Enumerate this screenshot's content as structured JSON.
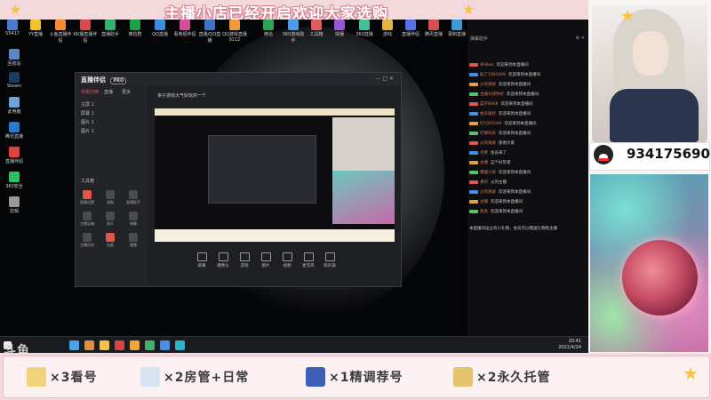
{
  "banner": {
    "title": "主播小店已经开启欢迎大家选购"
  },
  "desktop": {
    "top_icons": [
      "55417",
      "YY直播",
      "斗鱼直播伴侣",
      "KK播直播伴侣",
      "直播助手",
      "微信群",
      "QQ直播",
      "看电视伴侣",
      "直播/QQ直播",
      "QQ游戏直播9112",
      "微信",
      "360游戏助手",
      "工具箱",
      "快播",
      "360直播",
      "游戏",
      "直播伴侣",
      "腾讯直播",
      "录制直播",
      "TV直播"
    ],
    "side_icons": [
      "回收站",
      "Steam",
      "此电脑",
      "腾讯直播",
      "直播伴侣",
      "360安全",
      "剪辑"
    ]
  },
  "taskbar": {
    "time": "20:41",
    "date": "2022/4/24"
  },
  "app": {
    "title": "直播伴侣",
    "tag": "PRO",
    "tabs": [
      "场景切换",
      "直播",
      "更多"
    ],
    "scenes": [
      "主屏 1",
      "屏幕 1",
      "图片 1",
      "图片 1"
    ],
    "tools_title": "工具箱",
    "tools": [
      "直播设置",
      "录制",
      "直播助手",
      "主播宝箱",
      "观众",
      "弹幕",
      "主播任务",
      "连麦",
      "看播"
    ],
    "bottom_tools": [
      "屏幕",
      "摄像头",
      "游戏",
      "图片",
      "视频",
      "麦克风",
      "扬声器"
    ],
    "preview_title": "亲子游戏大气好玩的一个"
  },
  "chat": {
    "header": "弹幕助手",
    "lines": [
      {
        "user": "Wiilkes",
        "text": "欢迎来到本直播间"
      },
      {
        "user": "贴了1001h09",
        "text": "欢迎来到本直播间"
      },
      {
        "user": "火的清屏",
        "text": "欢迎来到本直播间"
      },
      {
        "user": "主播大叔你好",
        "text": "欢迎来到本直播间"
      },
      {
        "user": "菜子6666",
        "text": "欢迎来到本直播间"
      },
      {
        "user": "会员很好",
        "text": "欢迎来到本直播间"
      },
      {
        "user": "打1001h09",
        "text": "欢迎来到本直播间"
      },
      {
        "user": "打倒叫天",
        "text": "欢迎来到本直播间"
      },
      {
        "user": "火的清屏",
        "text": "感谢大家"
      },
      {
        "user": "大胖",
        "text": "会员来了"
      },
      {
        "user": "主播",
        "text": "这个好厉害"
      },
      {
        "user": "暴躁小孩",
        "text": "欢迎来到本直播间"
      },
      {
        "user": "真的",
        "text": "火的主播"
      },
      {
        "user": "火的清屏",
        "text": "欢迎来到本直播间"
      },
      {
        "user": "主播",
        "text": "欢迎来到本直播间"
      },
      {
        "user": "兔兔",
        "text": "欢迎来到本直播间"
      }
    ],
    "footer": "本直播间设立有小礼物，会员可以赠送礼物给主播"
  },
  "qq": {
    "number": "934175690"
  },
  "bottom": {
    "items": [
      {
        "text": "×3看号",
        "color": "#f2d27a"
      },
      {
        "text": "×2房管+日常",
        "color": "#d6e3f2"
      },
      {
        "text": "×1精调荐号",
        "color": "#3b5fb5"
      },
      {
        "text": "×2永久托管",
        "color": "#e5c26b"
      }
    ]
  },
  "watermark": "斗鱼"
}
